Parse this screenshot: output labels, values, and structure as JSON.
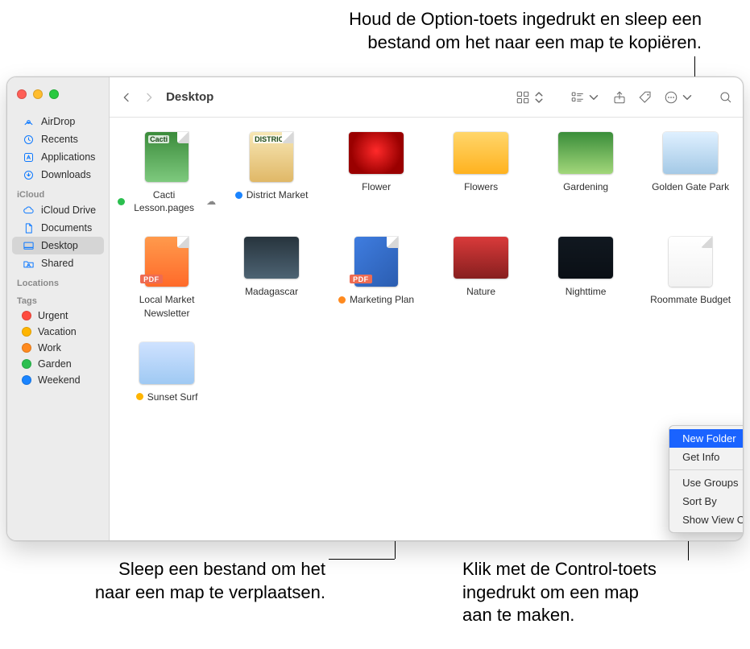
{
  "annotations": {
    "top": "Houd de Option-toets ingedrukt en sleep een\nbestand om het naar een map te kopiëren.",
    "bottom_left": "Sleep een bestand om het\nnaar een map te verplaatsen.",
    "bottom_right": "Klik met de Control-toets\ningedrukt om een map\naan te maken."
  },
  "window": {
    "title": "Desktop"
  },
  "sidebar": {
    "headings": {
      "icloud": "iCloud",
      "locations": "Locations",
      "tags": "Tags"
    },
    "favorites": [
      {
        "icon": "airdrop",
        "label": "AirDrop"
      },
      {
        "icon": "recents",
        "label": "Recents"
      },
      {
        "icon": "applications",
        "label": "Applications"
      },
      {
        "icon": "downloads",
        "label": "Downloads"
      }
    ],
    "icloud": [
      {
        "icon": "icloud",
        "label": "iCloud Drive"
      },
      {
        "icon": "documents",
        "label": "Documents"
      },
      {
        "icon": "desktop",
        "label": "Desktop",
        "selected": true
      },
      {
        "icon": "shared",
        "label": "Shared"
      }
    ],
    "tags": [
      {
        "color": "#ff4b3e",
        "label": "Urgent"
      },
      {
        "color": "#ffb500",
        "label": "Vacation"
      },
      {
        "color": "#ff8a1f",
        "label": "Work"
      },
      {
        "color": "#2bbf4f",
        "label": "Garden"
      },
      {
        "color": "#1a84ff",
        "label": "Weekend"
      }
    ]
  },
  "files": [
    {
      "name": "Cacti Lesson.pages",
      "tag": "#2bbf4f",
      "cloud": true,
      "thumb_type": "doc",
      "thumb_bg": "linear-gradient(#3b8b3b,#7ec97e)",
      "overlay_text": "Cacti"
    },
    {
      "name": "District Market",
      "tag": "#1a84ff",
      "thumb_type": "doc",
      "thumb_bg": "linear-gradient(#f7e7b5,#e0b867)",
      "overlay_text": "DISTRICT"
    },
    {
      "name": "Flower",
      "thumb_type": "img",
      "thumb_bg": "radial-gradient(circle at 50% 45%,#ff2a2a,#9a0000 70%)"
    },
    {
      "name": "Flowers",
      "thumb_type": "img",
      "thumb_bg": "linear-gradient(#ffd66b,#ffb21f)"
    },
    {
      "name": "Gardening",
      "thumb_type": "img",
      "thumb_bg": "linear-gradient(#3a8d3a,#a2d77a)"
    },
    {
      "name": "Golden Gate Park",
      "thumb_type": "img",
      "thumb_bg": "linear-gradient(#dff0ff,#a4c9e6)"
    },
    {
      "name": "Local Market Newsletter",
      "thumb_type": "doc",
      "pdf": true,
      "thumb_bg": "linear-gradient(#ff9a4c,#ff6a2a)"
    },
    {
      "name": "Madagascar",
      "thumb_type": "img",
      "thumb_bg": "linear-gradient(#27343d,#4d6373)"
    },
    {
      "name": "Marketing Plan",
      "tag": "#ff8a1f",
      "thumb_type": "doc",
      "pdf": true,
      "thumb_bg": "linear-gradient(135deg,#3f7de0,#2b5db0)"
    },
    {
      "name": "Nature",
      "thumb_type": "img",
      "thumb_bg": "linear-gradient(#d93a3a,#871f1f)"
    },
    {
      "name": "Nighttime",
      "thumb_type": "img",
      "thumb_bg": "linear-gradient(#111820,#0a0f15)"
    },
    {
      "name": "Roommate Budget",
      "thumb_type": "doc",
      "thumb_bg": "linear-gradient(#ffffff,#f2f2f2)"
    },
    {
      "name": "Sunset Surf",
      "tag": "#ffb500",
      "thumb_type": "img",
      "thumb_bg": "linear-gradient(#cfe2ff,#9fc9f3)"
    }
  ],
  "context_menu": {
    "items": [
      {
        "label": "New Folder",
        "selected": true
      },
      {
        "label": "Get Info"
      },
      {
        "sep": true
      },
      {
        "label": "Use Groups"
      },
      {
        "label": "Sort By",
        "submenu": true
      },
      {
        "label": "Show View Options"
      }
    ]
  },
  "icons": {
    "pdf_badge": "PDF",
    "cloud_glyph": "☁"
  }
}
